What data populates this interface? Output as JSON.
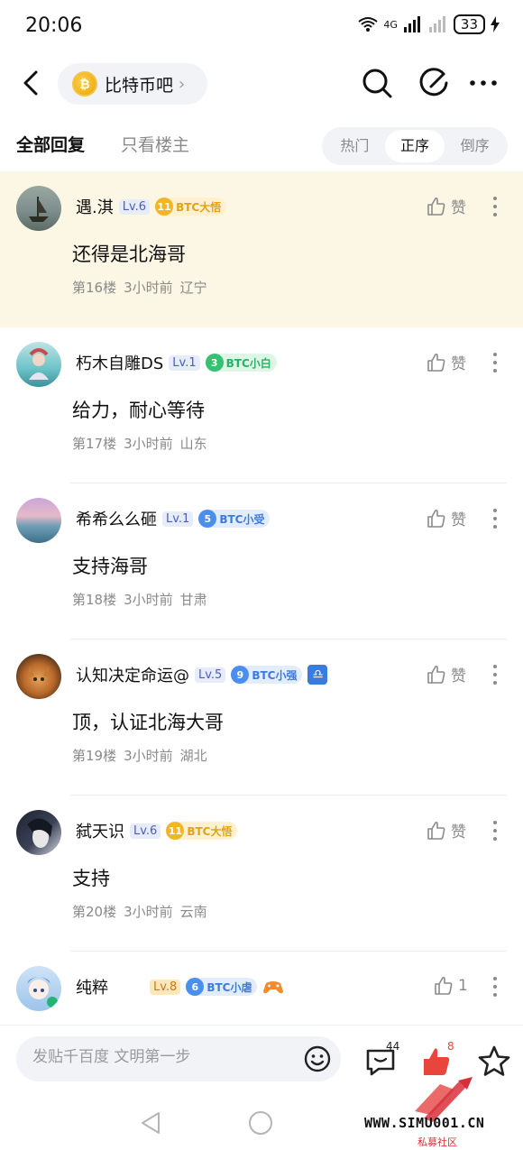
{
  "status_bar": {
    "time": "20:06",
    "network": "4G",
    "battery": "33"
  },
  "header": {
    "forum_name": "比特币吧"
  },
  "tabs": {
    "all": "全部回复",
    "op_only": "只看楼主"
  },
  "sort": [
    "热门",
    "正序",
    "倒序"
  ],
  "sort_active": "正序",
  "posts": [
    {
      "user": "遇.淇",
      "level": "Lv.6",
      "level_style": "blue",
      "badge_num": "11",
      "badge_label": "BTC大悟",
      "badge_color": "gold",
      "content": "还得是北海哥",
      "floor": "第16楼",
      "time": "3小时前",
      "location": "辽宁",
      "like": "赞",
      "highlight": true
    },
    {
      "user": "朽木自雕DS",
      "level": "Lv.1",
      "level_style": "blue",
      "badge_num": "3",
      "badge_label": "BTC小白",
      "badge_color": "green",
      "content": "给力，耐心等待",
      "floor": "第17楼",
      "time": "3小时前",
      "location": "山东",
      "like": "赞"
    },
    {
      "user": "希希么么砸",
      "level": "Lv.1",
      "level_style": "blue",
      "badge_num": "5",
      "badge_label": "BTC小受",
      "badge_color": "blue",
      "content": "支持海哥",
      "floor": "第18楼",
      "time": "3小时前",
      "location": "甘肃",
      "like": "赞"
    },
    {
      "user": "认知决定命运@",
      "level": "Lv.5",
      "level_style": "blue",
      "badge_num": "9",
      "badge_label": "BTC小强",
      "badge_color": "blue",
      "extra_icon": "♎",
      "content": "顶，认证北海大哥",
      "floor": "第19楼",
      "time": "3小时前",
      "location": "湖北",
      "like": "赞"
    },
    {
      "user": "弑天识",
      "level": "Lv.6",
      "level_style": "blue",
      "badge_num": "11",
      "badge_label": "BTC大悟",
      "badge_color": "gold",
      "content": "支持",
      "floor": "第20楼",
      "time": "3小时前",
      "location": "云南",
      "like": "赞"
    },
    {
      "user": "纯粹",
      "level": "Lv.8",
      "level_style": "gold",
      "badge_num": "6",
      "badge_label": "BTC小虐",
      "badge_color": "blue",
      "content": "",
      "floor": "",
      "time": "",
      "location": "",
      "like": "1"
    }
  ],
  "input_bar": {
    "placeholder": "发贴千百度 文明第一步",
    "comment_count": "44",
    "like_count": "8"
  },
  "watermark": {
    "url": "WWW.SIMU001.CN",
    "sub": "私募社区"
  },
  "colors": {
    "highlight_bg": "#fcf6e4",
    "like_red": "#e8453c",
    "accent_blue": "#3a7be0"
  }
}
